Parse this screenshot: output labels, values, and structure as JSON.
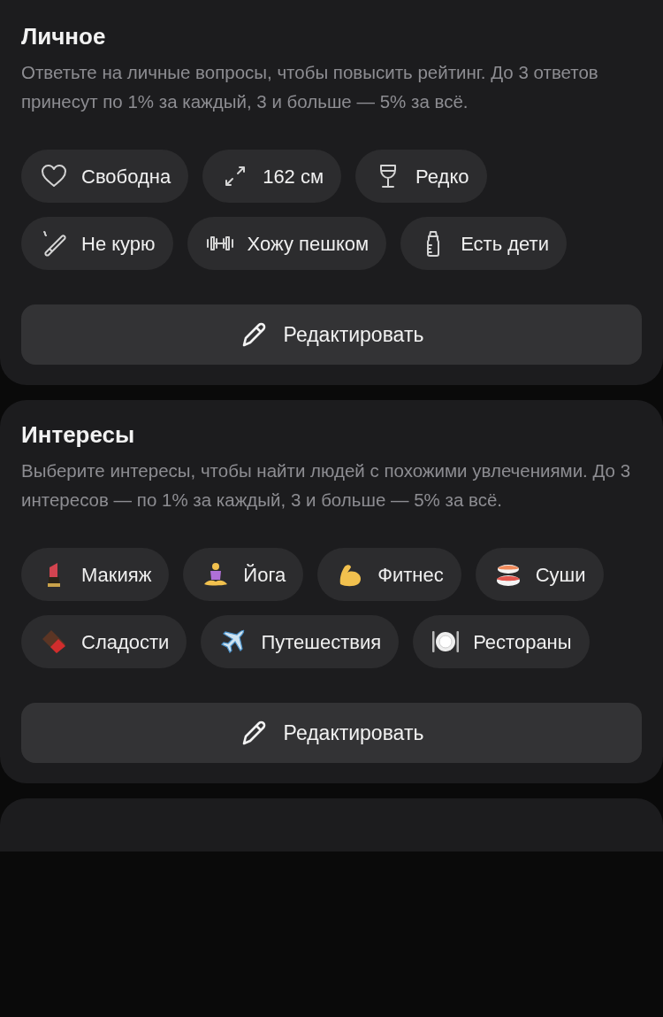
{
  "sections": [
    {
      "title": "Личное",
      "description": "Ответьте на личные вопросы, чтобы повысить рейтинг. До 3 ответов принесут по 1% за каждый, 3 и больше — 5% за всё.",
      "kind": "personal",
      "chips": [
        {
          "label": "Свободна"
        },
        {
          "label": "162 см"
        },
        {
          "label": "Редко"
        },
        {
          "label": "Не курю"
        },
        {
          "label": "Хожу пешком"
        },
        {
          "label": "Есть дети"
        }
      ],
      "button": "Редактировать"
    },
    {
      "title": "Интересы",
      "description": "Выберите интересы, чтобы найти людей с похожими увлечениями. До 3 интересов — по 1% за каждый, 3 и больше — 5% за всё.",
      "kind": "interests",
      "chips": [
        {
          "label": "Макияж"
        },
        {
          "label": "Йога"
        },
        {
          "label": "Фитнес"
        },
        {
          "label": "Суши"
        },
        {
          "label": "Сладости"
        },
        {
          "label": "Путешествия"
        },
        {
          "label": "Рестораны"
        }
      ],
      "button": "Редактировать"
    }
  ]
}
